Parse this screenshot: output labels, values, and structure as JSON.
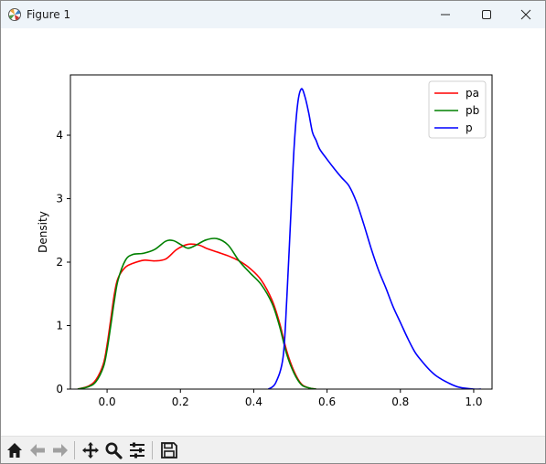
{
  "window": {
    "title": "Figure 1"
  },
  "colors": {
    "pa": "#ff0000",
    "pb": "#008000",
    "p": "#0000ff",
    "titlebar": "#eef4f9",
    "toolbar": "#f0f0f0"
  },
  "toolbar": {
    "icons": [
      "home-icon",
      "back-icon",
      "forward-icon",
      "pan-icon",
      "zoom-icon",
      "configure-subplots-icon",
      "save-icon"
    ]
  },
  "chart_data": {
    "type": "line",
    "title": "",
    "xlabel": "",
    "ylabel": "Density",
    "xlim": [
      -0.1,
      1.05
    ],
    "ylim": [
      0,
      4.95
    ],
    "xticks": [
      0.0,
      0.2,
      0.4,
      0.6,
      0.8,
      1.0
    ],
    "xtick_labels": [
      "0.0",
      "0.2",
      "0.4",
      "0.6",
      "0.8",
      "1.0"
    ],
    "yticks": [
      0,
      1,
      2,
      3,
      4
    ],
    "ytick_labels": [
      "0",
      "1",
      "2",
      "3",
      "4"
    ],
    "legend_position": "top-right",
    "series": [
      {
        "name": "pa",
        "color": "#ff0000",
        "x": [
          -0.08,
          -0.05,
          -0.03,
          -0.01,
          0.0,
          0.01,
          0.02,
          0.03,
          0.05,
          0.07,
          0.1,
          0.13,
          0.16,
          0.19,
          0.22,
          0.25,
          0.27,
          0.3,
          0.33,
          0.36,
          0.39,
          0.42,
          0.45,
          0.47,
          0.49,
          0.51,
          0.53,
          0.55,
          0.57
        ],
        "values": [
          0.0,
          0.05,
          0.15,
          0.4,
          0.7,
          1.1,
          1.5,
          1.75,
          1.92,
          1.98,
          2.03,
          2.02,
          2.05,
          2.2,
          2.28,
          2.27,
          2.22,
          2.16,
          2.1,
          2.02,
          1.9,
          1.72,
          1.4,
          1.05,
          0.6,
          0.28,
          0.08,
          0.02,
          0.0
        ]
      },
      {
        "name": "pb",
        "color": "#008000",
        "x": [
          -0.08,
          -0.05,
          -0.03,
          -0.01,
          0.0,
          0.01,
          0.02,
          0.03,
          0.05,
          0.07,
          0.1,
          0.13,
          0.16,
          0.18,
          0.2,
          0.22,
          0.24,
          0.27,
          0.3,
          0.33,
          0.36,
          0.39,
          0.42,
          0.45,
          0.47,
          0.49,
          0.51,
          0.53,
          0.55,
          0.57
        ],
        "values": [
          0.0,
          0.04,
          0.12,
          0.35,
          0.62,
          1.0,
          1.4,
          1.72,
          2.03,
          2.12,
          2.14,
          2.2,
          2.33,
          2.34,
          2.28,
          2.22,
          2.26,
          2.35,
          2.37,
          2.27,
          2.02,
          1.83,
          1.65,
          1.35,
          1.0,
          0.55,
          0.25,
          0.07,
          0.02,
          0.0
        ]
      },
      {
        "name": "p",
        "color": "#0000ff",
        "x": [
          0.44,
          0.46,
          0.48,
          0.49,
          0.5,
          0.51,
          0.52,
          0.53,
          0.54,
          0.55,
          0.56,
          0.57,
          0.58,
          0.6,
          0.62,
          0.64,
          0.66,
          0.68,
          0.7,
          0.72,
          0.74,
          0.76,
          0.78,
          0.8,
          0.82,
          0.84,
          0.86,
          0.88,
          0.9,
          0.93,
          0.96,
          1.0,
          1.02
        ],
        "values": [
          0.0,
          0.1,
          0.5,
          1.4,
          2.6,
          3.8,
          4.5,
          4.73,
          4.6,
          4.35,
          4.05,
          3.92,
          3.78,
          3.62,
          3.47,
          3.33,
          3.2,
          2.95,
          2.6,
          2.22,
          1.88,
          1.6,
          1.3,
          1.05,
          0.8,
          0.58,
          0.43,
          0.3,
          0.2,
          0.1,
          0.03,
          0.0,
          0.0
        ]
      }
    ]
  }
}
